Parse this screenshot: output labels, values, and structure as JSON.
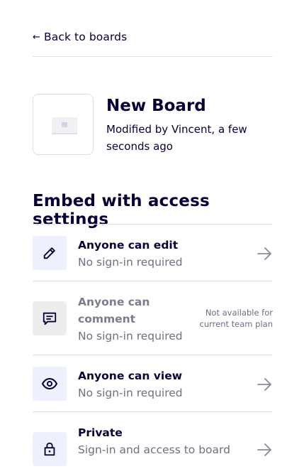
{
  "nav": {
    "back_label": "Back to boards",
    "back_icon": "arrow-left-icon"
  },
  "board": {
    "title": "New Board",
    "meta": "Modified by Vincent, a few seconds ago"
  },
  "section": {
    "title": "Embed with access settings"
  },
  "options": [
    {
      "icon": "pencil-icon",
      "label": "Anyone can edit",
      "sub": "No sign-in required",
      "enabled": true
    },
    {
      "icon": "comment-icon",
      "label": "Anyone can comment",
      "sub": "No sign-in required",
      "enabled": false,
      "note": "Not available for current team plan"
    },
    {
      "icon": "eye-icon",
      "label": "Anyone can view",
      "sub": "No sign-in required",
      "enabled": true
    },
    {
      "icon": "lock-icon",
      "label": "Private",
      "sub": "Sign-in and access to board",
      "enabled": true
    }
  ],
  "colors": {
    "text": "#050038",
    "muted": "#6f6e82",
    "icon_bg_active": "#eef0fd",
    "icon_bg_disabled": "#ededf0",
    "divider": "#e0e0e6"
  }
}
